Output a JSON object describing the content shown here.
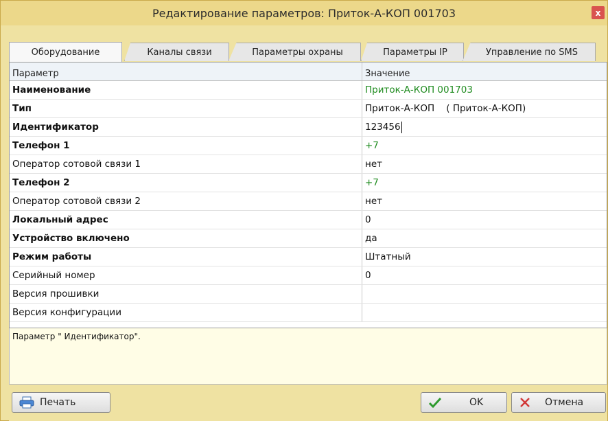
{
  "window": {
    "title": "Редактирование параметров: Приток-А-КОП 001703",
    "close_label": "x"
  },
  "tabs": [
    {
      "label": "Оборудование",
      "active": true
    },
    {
      "label": "Каналы связи",
      "active": false
    },
    {
      "label": "Параметры охраны",
      "active": false
    },
    {
      "label": "Параметры IP",
      "active": false
    },
    {
      "label": "Управление по SMS",
      "active": false
    }
  ],
  "grid": {
    "headers": {
      "param": "Параметр",
      "value": "Значение"
    },
    "rows": [
      {
        "param": "Наименование",
        "value": "Приток-А-КОП 001703",
        "bold": true,
        "value_color": "green"
      },
      {
        "param": "Тип",
        "value": "Приток-А-КОП    ( Приток-А-КОП)",
        "bold": true
      },
      {
        "param": "Идентификатор",
        "value": "123456",
        "bold": true,
        "editing": true
      },
      {
        "param": "Телефон 1",
        "value": "+7",
        "bold": true,
        "value_color": "green"
      },
      {
        "param": "Оператор сотовой связи 1",
        "value": "нет",
        "bold": false
      },
      {
        "param": "Телефон 2",
        "value": "+7",
        "bold": true,
        "value_color": "green"
      },
      {
        "param": "Оператор сотовой связи 2",
        "value": "нет",
        "bold": false
      },
      {
        "param": "Локальный адрес",
        "value": "0",
        "bold": true
      },
      {
        "param": "Устройство включено",
        "value": "да",
        "bold": true
      },
      {
        "param": "Режим работы",
        "value": "Штатный",
        "bold": true
      },
      {
        "param": "Серийный номер",
        "value": "0",
        "bold": false
      },
      {
        "param": "Версия прошивки",
        "value": "",
        "bold": false
      },
      {
        "param": "Версия конфигурации",
        "value": "",
        "bold": false
      }
    ]
  },
  "description": "Параметр \" Идентификатор\".",
  "buttons": {
    "print": "Печать",
    "ok": "OK",
    "cancel": "Отмена"
  },
  "colors": {
    "window_bg": "#efe2a2",
    "value_green": "#1e8b1e",
    "close_red": "#d9534f"
  }
}
